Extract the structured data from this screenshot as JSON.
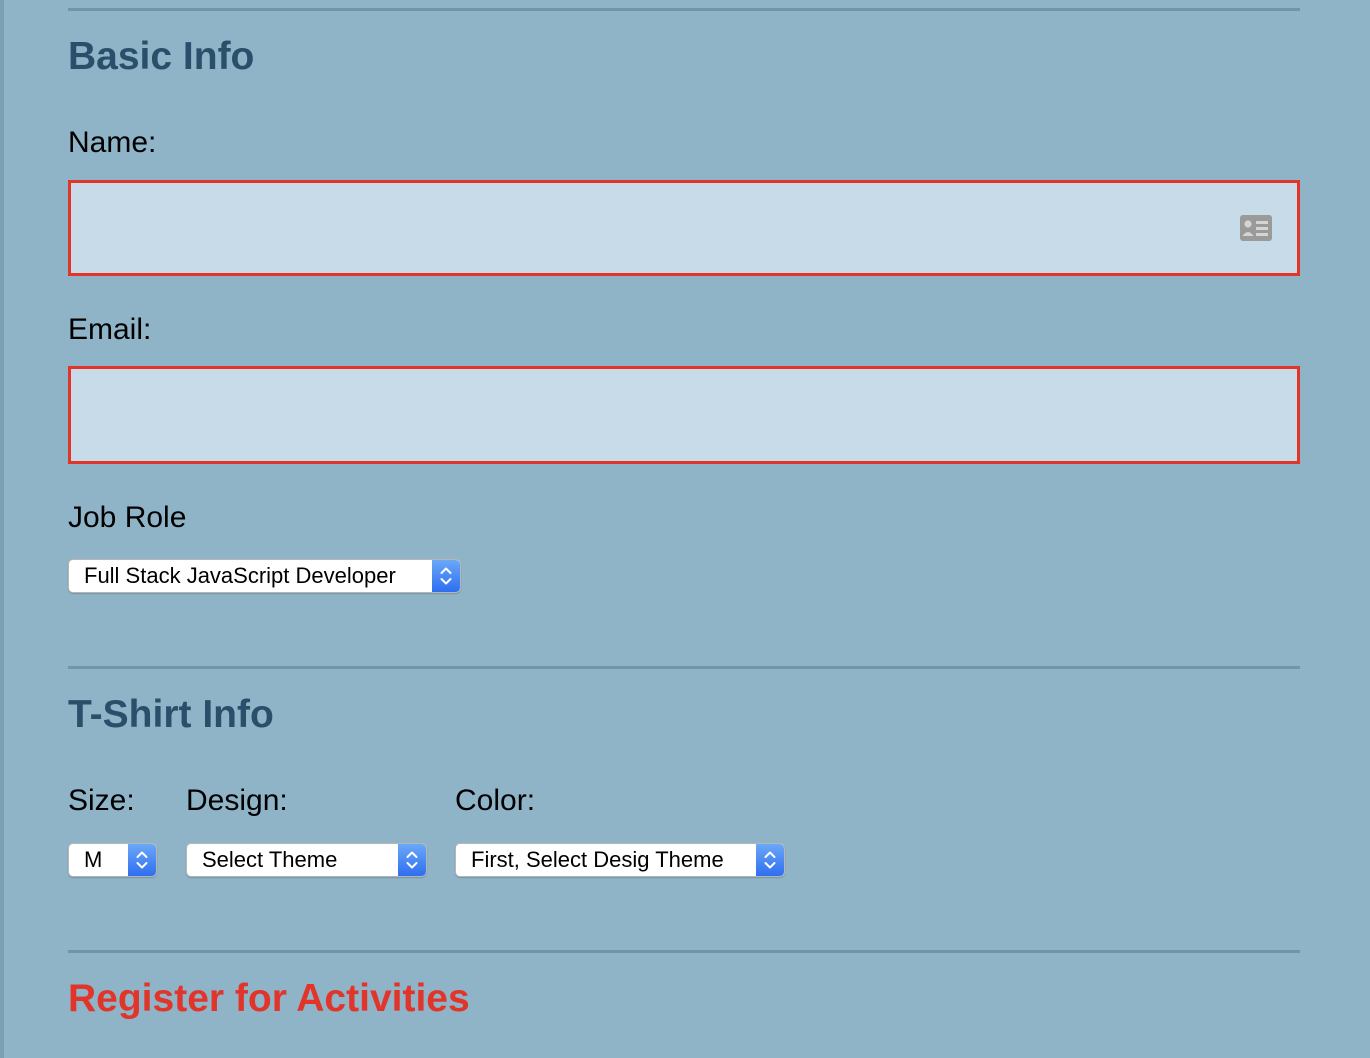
{
  "basic_info": {
    "title": "Basic Info",
    "name_label": "Name:",
    "name_value": "",
    "email_label": "Email:",
    "email_value": "",
    "job_role_label": "Job Role",
    "job_role_selected": "Full Stack JavaScript Developer"
  },
  "tshirt_info": {
    "title": "T-Shirt Info",
    "size_label": "Size:",
    "size_selected": "M",
    "design_label": "Design:",
    "design_selected": "Select Theme",
    "color_label": "Color:",
    "color_selected": "First, Select Desig Theme"
  },
  "activities": {
    "title": "Register for Activities"
  },
  "icons": {
    "name_field_icon": "contact-card-icon",
    "select_stepper_icon": "chevron-up-down-icon"
  },
  "colors": {
    "page_background": "#8fb3c7",
    "section_title": "#294f6b",
    "error_accent": "#e2352a",
    "input_background": "#c7dce8",
    "divider": "#6d95ab",
    "stepper_blue": "#2f6ef0"
  }
}
